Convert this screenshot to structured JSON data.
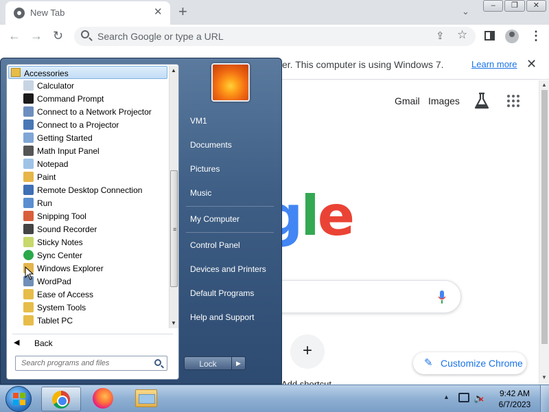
{
  "browser": {
    "tab_title": "New Tab",
    "omnibox_placeholder": "Search Google or type a URL"
  },
  "infobar": {
    "message": "er. This computer is using Windows 7.",
    "link": "Learn more"
  },
  "newtab": {
    "gmail": "Gmail",
    "images": "Images",
    "logo_letters": [
      "g",
      "l",
      "e"
    ],
    "shortcut_label": "Add shortcut",
    "customize": "Customize Chrome"
  },
  "start_menu": {
    "folder": "Accessories",
    "programs": [
      {
        "label": "Calculator",
        "icon": "calculator-icon"
      },
      {
        "label": "Command Prompt",
        "icon": "cmd-icon"
      },
      {
        "label": "Connect to a Network Projector",
        "icon": "network-projector-icon"
      },
      {
        "label": "Connect to a Projector",
        "icon": "projector-icon"
      },
      {
        "label": "Getting Started",
        "icon": "getting-started-icon"
      },
      {
        "label": "Math Input Panel",
        "icon": "math-input-icon"
      },
      {
        "label": "Notepad",
        "icon": "notepad-icon"
      },
      {
        "label": "Paint",
        "icon": "paint-icon"
      },
      {
        "label": "Remote Desktop Connection",
        "icon": "remote-desktop-icon"
      },
      {
        "label": "Run",
        "icon": "run-icon"
      },
      {
        "label": "Snipping Tool",
        "icon": "snipping-tool-icon"
      },
      {
        "label": "Sound Recorder",
        "icon": "microphone-icon"
      },
      {
        "label": "Sticky Notes",
        "icon": "sticky-notes-icon"
      },
      {
        "label": "Sync Center",
        "icon": "sync-icon"
      },
      {
        "label": "Windows Explorer",
        "icon": "explorer-icon"
      },
      {
        "label": "WordPad",
        "icon": "wordpad-icon"
      },
      {
        "label": "Ease of Access",
        "icon": "folder-icon"
      },
      {
        "label": "System Tools",
        "icon": "folder-icon"
      },
      {
        "label": "Tablet PC",
        "icon": "folder-icon"
      }
    ],
    "back": "Back",
    "search_placeholder": "Search programs and files",
    "right_links": [
      "VM1",
      "Documents",
      "Pictures",
      "Music",
      "My Computer",
      "Control Panel",
      "Devices and Printers",
      "Default Programs",
      "Help and Support"
    ],
    "lock": "Lock"
  },
  "taskbar": {
    "time": "9:42 AM",
    "date": "6/7/2023"
  },
  "colors": {
    "accent": "#1a73e8",
    "google_blue": "#4285f4",
    "google_red": "#ea4335",
    "google_yellow": "#fbbc05",
    "google_green": "#34a853"
  }
}
